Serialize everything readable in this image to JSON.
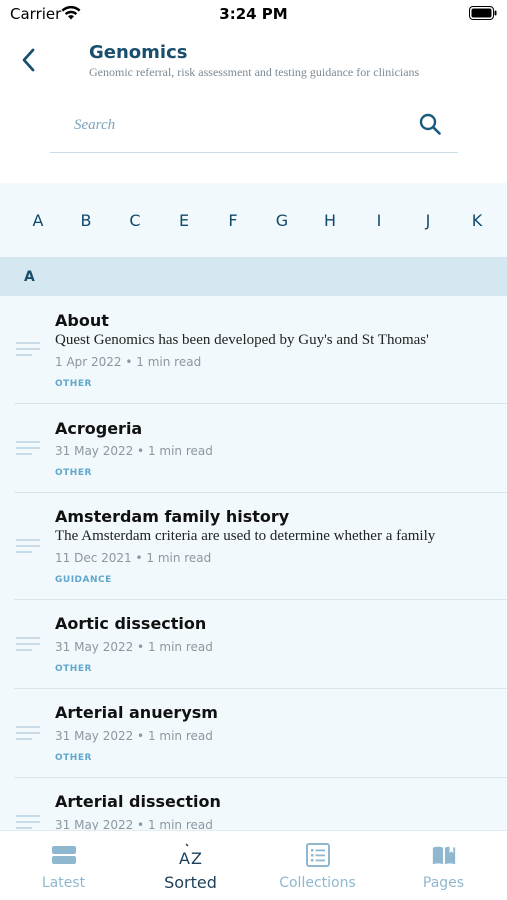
{
  "status_bar": {
    "carrier": "Carrier",
    "time": "3:24 PM"
  },
  "header": {
    "title": "Genomics",
    "subtitle": "Genomic referral, risk assessment and testing guidance for clinicians"
  },
  "search": {
    "placeholder": "Search"
  },
  "alphabet": [
    "A",
    "B",
    "C",
    "E",
    "F",
    "G",
    "H",
    "I",
    "J",
    "K"
  ],
  "section": {
    "letter": "A"
  },
  "items": [
    {
      "title": "About",
      "description": "Quest Genomics has been developed by Guy's and St Thomas'",
      "meta": "1 Apr 2022 • 1 min read",
      "tag": "OTHER"
    },
    {
      "title": "Acrogeria",
      "description": "",
      "meta": "31 May 2022 • 1 min read",
      "tag": "OTHER"
    },
    {
      "title": "Amsterdam family history",
      "description": "The Amsterdam criteria are used to determine whether a family",
      "meta": "11 Dec 2021 • 1 min read",
      "tag": "GUIDANCE"
    },
    {
      "title": "Aortic dissection",
      "description": "",
      "meta": "31 May 2022 • 1 min read",
      "tag": "OTHER"
    },
    {
      "title": "Arterial anuerysm",
      "description": "",
      "meta": "31 May 2022 • 1 min read",
      "tag": "OTHER"
    },
    {
      "title": "Arterial dissection",
      "description": "",
      "meta": "31 May 2022 • 1 min read",
      "tag": ""
    }
  ],
  "tabs": [
    {
      "label": "Latest",
      "icon": "stack-icon",
      "active": false
    },
    {
      "label": "Sorted",
      "icon": "az-sort-icon",
      "active": true
    },
    {
      "label": "Collections",
      "icon": "list-icon",
      "active": false
    },
    {
      "label": "Pages",
      "icon": "book-icon",
      "active": false
    }
  ],
  "colors": {
    "accent": "#1a4e6e",
    "tag": "#5fa7cc",
    "list_background": "#f2f9fc",
    "section_background": "#d5e7f1",
    "inactive_tab": "#8fb8d0"
  }
}
